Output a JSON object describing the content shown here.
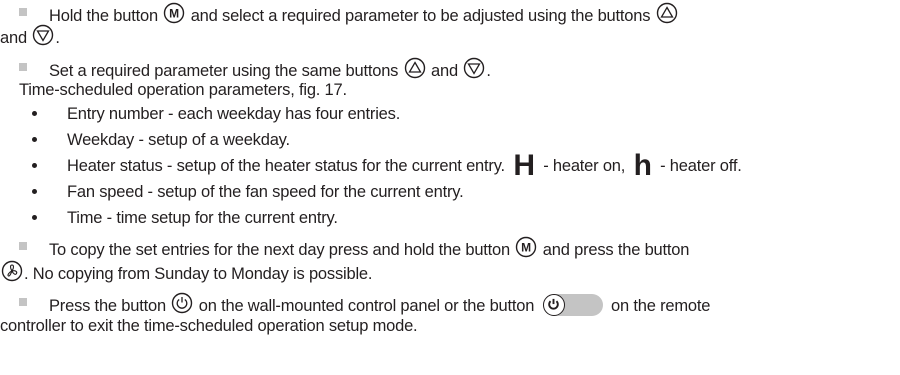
{
  "paragraphs": {
    "p1_a": "Hold the button",
    "p1_b": "and select a required parameter to be adjusted using the buttons",
    "p1_c": "and",
    "p1_end": ".",
    "p2_a": "Set a required parameter using the same buttons",
    "p2_b": "and",
    "p2_end": ".",
    "p3": "Time-scheduled operation parameters, fig. 17.",
    "p4_a": "To copy the set entries for the next day press and hold the button",
    "p4_b": "and press the button",
    "p4_c": ". No copying from Sunday to Monday is possible.",
    "p5_a": "Press the button",
    "p5_b": "on the wall-mounted control panel or the button",
    "p5_c": "on the remote",
    "p5_d": "controller to exit the time-scheduled operation setup mode."
  },
  "bullets": [
    "Entry number - each weekday has four entries.",
    "Weekday - setup of a weekday."
  ],
  "heater_bullet": {
    "a": "Heater status - setup of the heater status for the current entry.",
    "on_symbol": "H",
    "b": "- heater on,",
    "off_symbol": "h",
    "c": "- heater off."
  },
  "bullets2": [
    "Fan speed - setup of the fan speed for the current entry.",
    "Time - time setup for the current entry."
  ],
  "icons": {
    "m_label": "M"
  }
}
